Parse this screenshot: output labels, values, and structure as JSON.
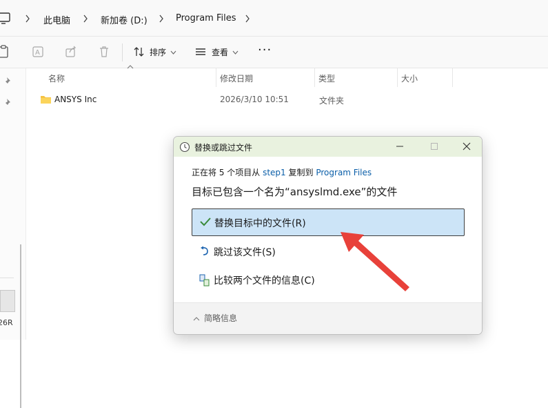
{
  "breadcrumb": {
    "items": [
      "此电脑",
      "新加卷 (D:)",
      "Program Files"
    ]
  },
  "toolbar": {
    "sort_label": "排序",
    "view_label": "查看",
    "more_label": "···"
  },
  "columns": {
    "name": "名称",
    "modified": "修改日期",
    "type": "类型",
    "size": "大小"
  },
  "files": [
    {
      "name": "ANSYS Inc",
      "modified": "2026/3/10 10:51",
      "type": "文件夹"
    }
  ],
  "nav_fragment": "26R",
  "dialog": {
    "title": "替换或跳过文件",
    "info_prefix": "正在将 5 个项目从",
    "info_source": "step1",
    "info_middle": "复制到",
    "info_dest": "Program Files",
    "heading": "目标已包含一个名为“ansyslmd.exe”的文件",
    "options": [
      {
        "label": "替换目标中的文件(R)",
        "icon": "checkmark-icon",
        "selected": true
      },
      {
        "label": "跳过该文件(S)",
        "icon": "skip-arrow-icon",
        "selected": false
      },
      {
        "label": "比较两个文件的信息(C)",
        "icon": "compare-icon",
        "selected": false
      }
    ],
    "footer_label": "简略信息"
  },
  "colors": {
    "title_bar": "#e9f2df",
    "selected_option": "#cce4f7",
    "link": "#0a5ea8",
    "annotation_arrow": "#e8413a"
  }
}
